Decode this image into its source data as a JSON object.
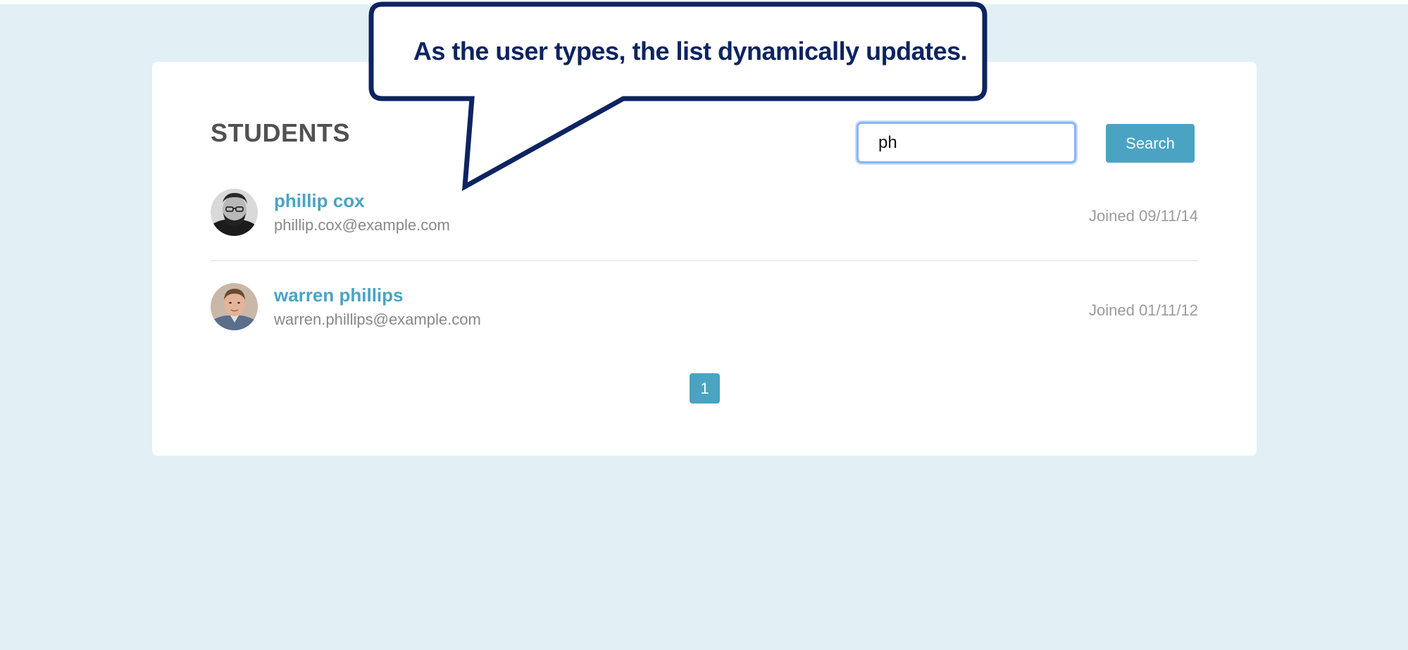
{
  "callout": {
    "text": "As the user types, the list dynamically updates."
  },
  "students_page": {
    "title": "STUDENTS",
    "search": {
      "value": "ph",
      "button_label": "Search"
    },
    "students": [
      {
        "name": "phillip cox",
        "email": "phillip.cox@example.com",
        "joined": "Joined 09/11/14",
        "avatar": "avatar-bearded-man-bw"
      },
      {
        "name": "warren phillips",
        "email": "warren.phillips@example.com",
        "joined": "Joined 01/11/12",
        "avatar": "avatar-young-man-color"
      }
    ],
    "pagination": {
      "pages": [
        "1"
      ],
      "current": "1"
    }
  },
  "colors": {
    "background": "#e2f0f5",
    "accent": "#4ba3c3",
    "callout_border": "#0d2461"
  }
}
